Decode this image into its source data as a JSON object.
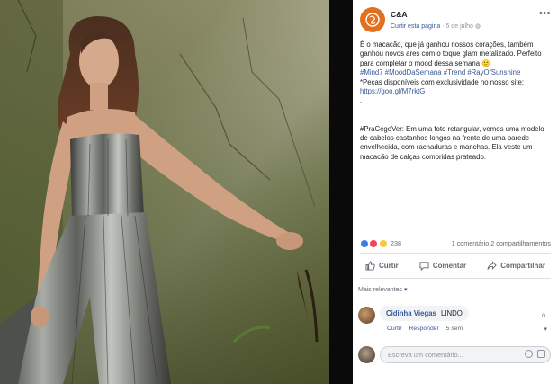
{
  "post": {
    "page_name": "C&A",
    "follow_label": "Curtir esta página",
    "date": "5 de julho",
    "text_lines": [
      "É o macacão, que já ganhou nossos corações, também ganhou novos ares com o toque glam metalizado. Perfeito para completar o mood dessa semana 🙂",
      "#Mind7 #MoodDaSemana #Trend #RayOfSunshine",
      "*Peças disponíveis com exclusividade no nosso site:",
      "https://goo.gl/M7rktG",
      ".",
      ".",
      ".",
      "#PraCegoVer: Em uma foto retangular, vemos uma modelo de cabelos castanhos longos na frente de uma parede envelhecida, com rachaduras e manchas. Ela veste um macacão de calças compridas prateado."
    ],
    "reaction_count": "238",
    "comment_count": "1 comentário",
    "share_count": "2 compartilhamentos"
  },
  "actions": {
    "like_label": "Curtir",
    "comment_label": "Comentar",
    "share_label": "Compartilhar"
  },
  "comments": {
    "filter_label": "Mais relevantes",
    "items": [
      {
        "author": "Cidinha Viegas",
        "text": "LINDO",
        "like_label": "Curtir",
        "reply_label": "Responder",
        "time": "5 sem",
        "likes": "0"
      }
    ],
    "write_placeholder": "Escreva um comentário..."
  },
  "colors": {
    "brand": "#e2701f",
    "link": "#385898"
  }
}
